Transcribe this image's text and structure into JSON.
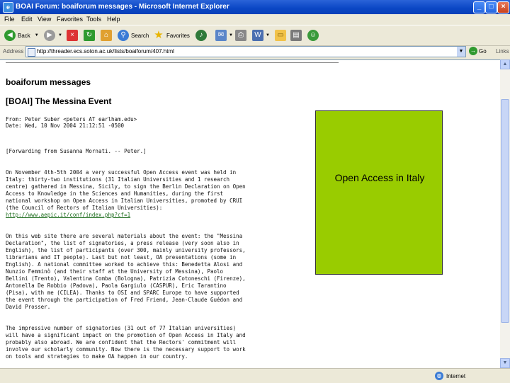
{
  "window": {
    "title": "BOAI Forum: boaiforum messages - Microsoft Internet Explorer",
    "minimize": "_",
    "maximize": "□",
    "close": "×"
  },
  "menu": [
    "File",
    "Edit",
    "View",
    "Favorites",
    "Tools",
    "Help"
  ],
  "toolbar": {
    "back": "Back",
    "search": "Search",
    "favorites": "Favorites"
  },
  "address": {
    "label": "Address",
    "url": "http://threader.ecs.soton.ac.uk/lists/boaiforum/407.html",
    "go": "Go",
    "links": "Links"
  },
  "page": {
    "heading": "boaiforum messages",
    "subject": "[BOAI] The Messina Event",
    "from": "From: Peter Suber <peters AT earlham.edu>",
    "date": "Date: Wed, 10 Nov 2004 21:12:51 -0500",
    "forward": "[Forwarding from Susanna Mornati.  -- Peter.]",
    "p1": [
      "On November 4th-5th 2004 a very successful Open Access event was held in",
      "Italy: thirty-two institutions (31 Italian Universities and 1 research",
      "centre) gathered in Messina, Sicily, to sign the Berlin Declaration on Open",
      "Access to Knowledge in the Sciences and Humanities, during the first",
      "national workshop on Open Access in Italian Universities, promoted by CRUI",
      "(the Council of Rectors of Italian Universities):"
    ],
    "p1_link": "http://www.aepic.it/conf/index.php?cf=1",
    "p2": [
      "On this web site there are several materials about the event: the \"Messina",
      "Declaration\", the list of signatories, a press release (very soon also in",
      "English), the list of participants (over 300, mainly university professors,",
      "librarians and IT people). Last but not least, OA presentations (some in",
      "English). A national committee worked to achieve this: Benedetta Alosi and",
      "Nunzio Femminò (and their staff at the University of Messina), Paolo",
      "Bellini (Trento), Valentina Comba (Bologna), Patrizia Cotoneschi (Firenze),",
      "Antonella De Robbio (Padova), Paola Gargiulo (CASPUR), Eric Tarantino",
      "(Pisa), with me (CILEA). Thanks to OSI and SPARC Europe to have supported",
      "the event through the participation of Fred Friend, Jean-Claude Guédon and",
      "David Prosser."
    ],
    "p3": [
      "The impressive number of signatories (31 out of 77 Italian universities)",
      "will have a significant impact on the promotion of Open Access in Italy and",
      "probably also abroad. We are confident that the Rectors' commitment will",
      "involve our scholarly community. Now there is the necessary support to work",
      "on tools and strategies to make OA happen in our country."
    ]
  },
  "callout": {
    "text": "Open Access in Italy",
    "color": "#99cc00"
  },
  "status": {
    "zone": "Internet"
  }
}
